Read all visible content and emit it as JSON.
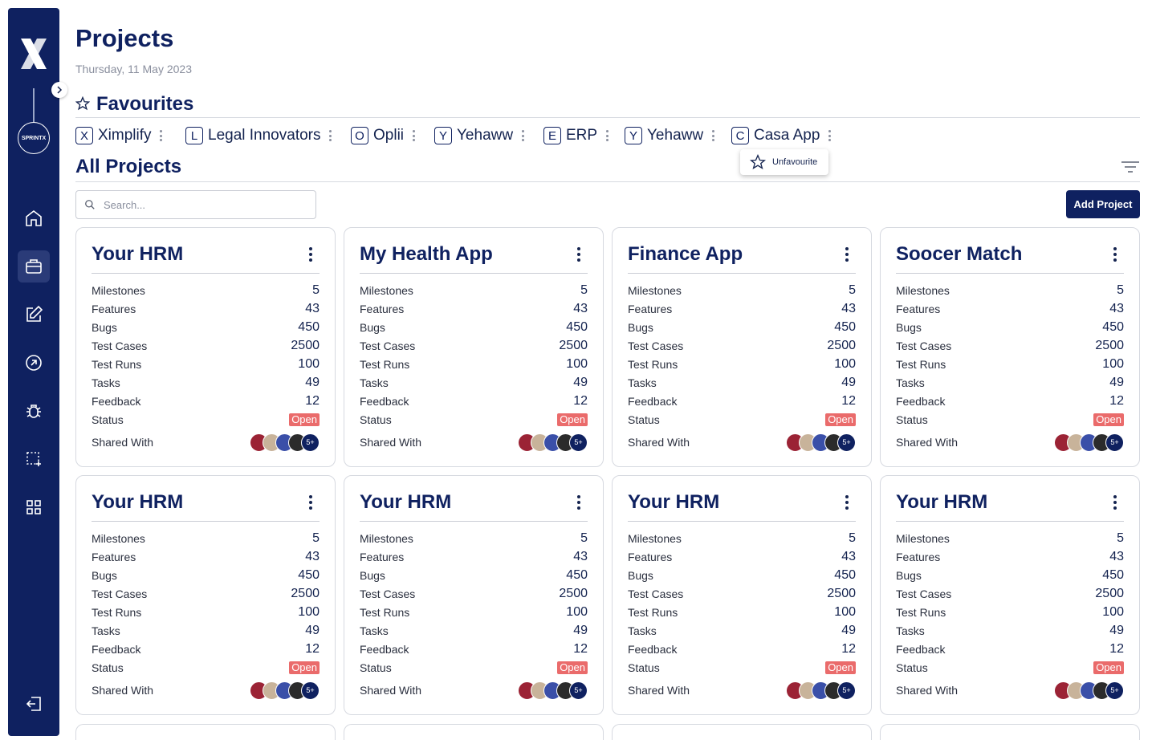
{
  "page": {
    "title": "Projects",
    "date": "Thursday, 11 May 2023"
  },
  "sidebar": {
    "brand_badge": "SPRINTX",
    "items": [
      {
        "icon": "home-icon"
      },
      {
        "icon": "briefcase-icon",
        "active": true
      },
      {
        "icon": "edit-icon"
      },
      {
        "icon": "arrow-up-right-circle-icon"
      },
      {
        "icon": "bug-icon"
      },
      {
        "icon": "select-add-icon"
      },
      {
        "icon": "grid-icon"
      }
    ],
    "logout_icon": "logout-icon"
  },
  "favourites": {
    "title": "Favourites",
    "items": [
      {
        "letter": "X",
        "name": "Ximplify"
      },
      {
        "letter": "L",
        "name": "Legal Innovators"
      },
      {
        "letter": "O",
        "name": "Oplii"
      },
      {
        "letter": "Y",
        "name": "Yehaww"
      },
      {
        "letter": "E",
        "name": "ERP"
      },
      {
        "letter": "Y",
        "name": "Yehaww"
      },
      {
        "letter": "C",
        "name": "Casa App"
      }
    ],
    "popup_label": "Unfavourite"
  },
  "all_projects": {
    "title": "All Projects",
    "search_placeholder": "Search...",
    "add_button": "Add Project"
  },
  "stat_labels": {
    "milestones": "Milestones",
    "features": "Features",
    "bugs": "Bugs",
    "test_cases": "Test Cases",
    "test_runs": "Test Runs",
    "tasks": "Tasks",
    "feedback": "Feedback",
    "status": "Status",
    "shared_with": "Shared With"
  },
  "projects": [
    {
      "name": "Your HRM",
      "milestones": "5",
      "features": "43",
      "bugs": "450",
      "test_cases": "2500",
      "test_runs": "100",
      "tasks": "49",
      "feedback": "12",
      "status": "Open",
      "more": "5+"
    },
    {
      "name": "My Health App",
      "milestones": "5",
      "features": "43",
      "bugs": "450",
      "test_cases": "2500",
      "test_runs": "100",
      "tasks": "49",
      "feedback": "12",
      "status": "Open",
      "more": "5+"
    },
    {
      "name": "Finance App",
      "milestones": "5",
      "features": "43",
      "bugs": "450",
      "test_cases": "2500",
      "test_runs": "100",
      "tasks": "49",
      "feedback": "12",
      "status": "Open",
      "more": "5+"
    },
    {
      "name": "Soocer Match",
      "milestones": "5",
      "features": "43",
      "bugs": "450",
      "test_cases": "2500",
      "test_runs": "100",
      "tasks": "49",
      "feedback": "12",
      "status": "Open",
      "more": "5+"
    },
    {
      "name": "Your HRM",
      "milestones": "5",
      "features": "43",
      "bugs": "450",
      "test_cases": "2500",
      "test_runs": "100",
      "tasks": "49",
      "feedback": "12",
      "status": "Open",
      "more": "5+"
    },
    {
      "name": "Your HRM",
      "milestones": "5",
      "features": "43",
      "bugs": "450",
      "test_cases": "2500",
      "test_runs": "100",
      "tasks": "49",
      "feedback": "12",
      "status": "Open",
      "more": "5+"
    },
    {
      "name": "Your HRM",
      "milestones": "5",
      "features": "43",
      "bugs": "450",
      "test_cases": "2500",
      "test_runs": "100",
      "tasks": "49",
      "feedback": "12",
      "status": "Open",
      "more": "5+"
    },
    {
      "name": "Your HRM",
      "milestones": "5",
      "features": "43",
      "bugs": "450",
      "test_cases": "2500",
      "test_runs": "100",
      "tasks": "49",
      "feedback": "12",
      "status": "Open",
      "more": "5+"
    }
  ],
  "colors": {
    "brand": "#0f2160",
    "status_open": "#ea6b6b",
    "avatar_colors": [
      "#9b2335",
      "#c8b39a",
      "#3a4fa8",
      "#2b2b2b"
    ]
  }
}
